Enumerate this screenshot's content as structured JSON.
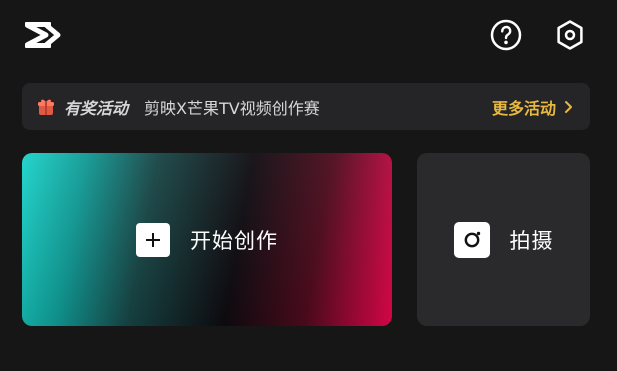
{
  "header": {
    "logo_icon": "capcut-logo-icon",
    "help_icon": "question-circle-icon",
    "settings_icon": "hexagon-settings-icon"
  },
  "banner": {
    "icon": "gift-icon",
    "tag": "有奖活动",
    "text": "剪映X芒果TV视频创作赛",
    "link_label": "更多活动",
    "link_icon": "chevron-right-icon",
    "link_color": "#e7b93e"
  },
  "main": {
    "create": {
      "icon": "plus-icon",
      "label": "开始创作"
    },
    "shoot": {
      "icon": "camera-icon",
      "label": "拍摄"
    }
  }
}
